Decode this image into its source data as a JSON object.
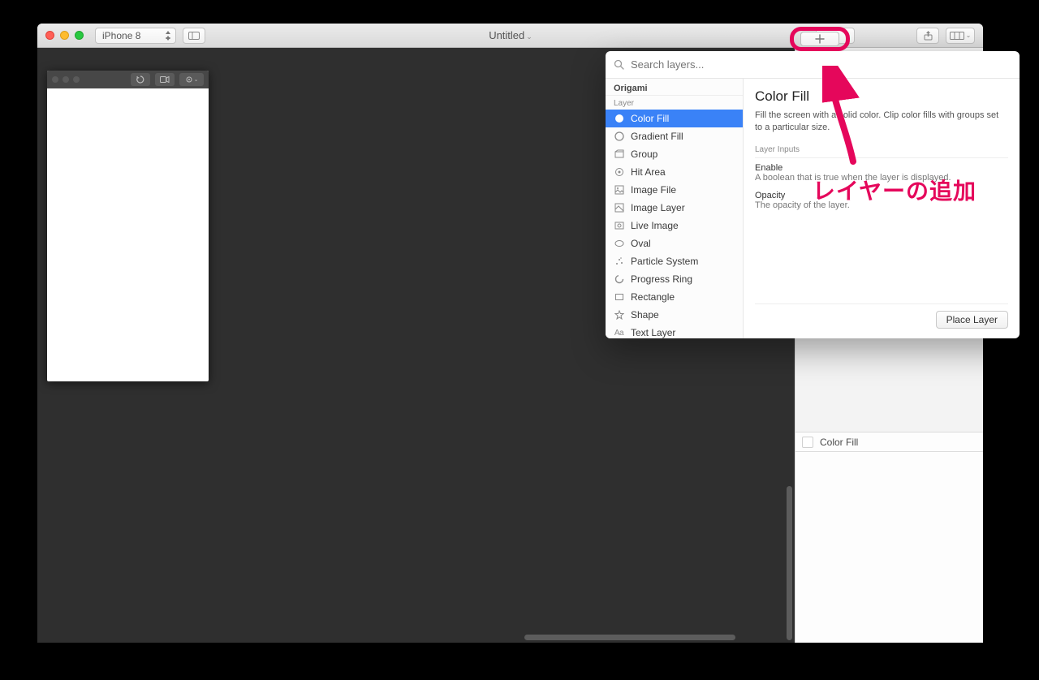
{
  "toolbar": {
    "device": "iPhone 8",
    "title": "Untitled"
  },
  "popover": {
    "search_placeholder": "Search layers...",
    "category": "Origami",
    "group": "Layer",
    "items": [
      "Color Fill",
      "Gradient Fill",
      "Group",
      "Hit Area",
      "Image File",
      "Image Layer",
      "Live Image",
      "Oval",
      "Particle System",
      "Progress Ring",
      "Rectangle",
      "Shape",
      "Text Layer"
    ],
    "selected_index": 0,
    "detail": {
      "title": "Color Fill",
      "description": "Fill the screen with a solid color. Clip color fills with groups set to a particular size.",
      "section": "Layer Inputs",
      "params": [
        {
          "name": "Enable",
          "desc": "A boolean that is true when the layer is displayed."
        },
        {
          "name": "Opacity",
          "desc": "The opacity of the layer."
        }
      ],
      "action": "Place Layer"
    }
  },
  "right_sidebar": {
    "layer_name": "Color Fill"
  },
  "callout": {
    "text": "レイヤーの追加"
  }
}
